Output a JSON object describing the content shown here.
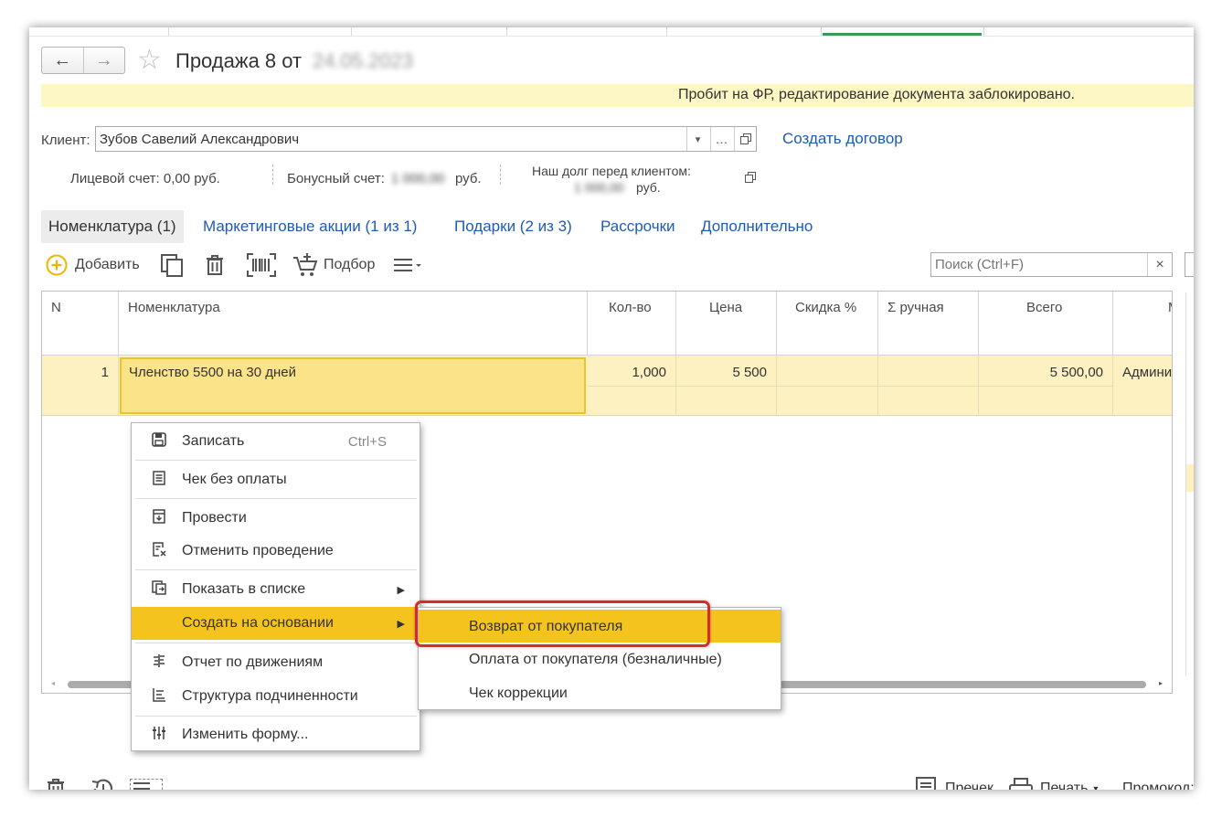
{
  "header": {
    "title": "Продажа 8 от",
    "date_blurred": "24.05.2023",
    "back_icon": "←",
    "forward_icon": "→",
    "favorite_icon": "☆"
  },
  "banner": {
    "text": "Пробит на ФР, редактирование документа заблокировано."
  },
  "client": {
    "label": "Клиент:",
    "value": "Зубов Савелий Александрович",
    "create_contract_link": "Создать договор"
  },
  "accounts": {
    "personal_label": "Лицевой счет: 0,00  руб.",
    "bonus_label": "Бонусный счет:",
    "bonus_value": "1 000,00",
    "bonus_currency": "руб.",
    "debt_label": "Наш долг перед клиентом:",
    "debt_value": "1 000,00",
    "debt_currency": "руб."
  },
  "tabs": [
    {
      "label": "Номенклатура (1)"
    },
    {
      "label": "Маркетинговые акции (1 из 1)"
    },
    {
      "label": "Подарки (2 из 3)"
    },
    {
      "label": "Рассрочки"
    },
    {
      "label": "Дополнительно"
    }
  ],
  "toolbar": {
    "add_label": "Добавить",
    "pick_label": "Подбор",
    "search_placeholder": "Поиск (Ctrl+F)",
    "clear_icon": "×"
  },
  "table": {
    "columns": [
      "N",
      "Номенклатура",
      "Кол-во",
      "Цена",
      "Скидка %",
      "Σ ручная",
      "Всего",
      "М"
    ],
    "rows": [
      {
        "n": "1",
        "item": "Членство 5500 на 30 дней",
        "qty": "1,000",
        "price": "5 500",
        "discount": "",
        "manual": "",
        "total": "5 500,00",
        "extra": "Админи"
      }
    ]
  },
  "context_menu": {
    "items": [
      {
        "label": "Записать",
        "shortcut": "Ctrl+S"
      },
      {
        "label": "Чек без оплаты"
      },
      {
        "label": "Провести"
      },
      {
        "label": "Отменить проведение"
      },
      {
        "label": "Показать в списке"
      },
      {
        "label": "Создать на основании"
      },
      {
        "label": "Отчет по движениям"
      },
      {
        "label": "Структура подчиненности"
      },
      {
        "label": "Изменить форму..."
      }
    ]
  },
  "submenu": {
    "items": [
      {
        "label": "Возврат от покупателя"
      },
      {
        "label": "Оплата от покупателя (безналичные)"
      },
      {
        "label": "Чек коррекции"
      }
    ]
  },
  "bottom_bar": {
    "receipt_label": "Пречек",
    "print_label": "Печать",
    "promo_label": "Промокод:"
  },
  "colors": {
    "highlight": "#f5c31e",
    "link": "#1f5bb5",
    "banner": "#fdf6c5",
    "annotation": "#d12d2d"
  }
}
